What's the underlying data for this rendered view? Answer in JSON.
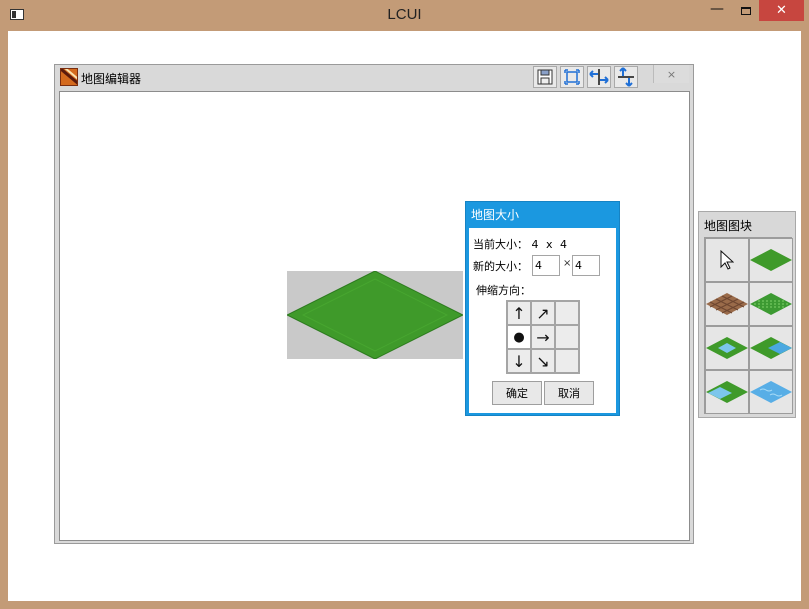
{
  "window": {
    "title": "LCUI"
  },
  "editor": {
    "title": "地图编辑器",
    "toolbar": {
      "save": "save-icon",
      "fit": "fit-frame-icon",
      "flip_horizontal": "flip-horizontal-icon",
      "flip_vertical": "flip-vertical-icon",
      "close_label": "×"
    },
    "colors": {
      "grass": "#3f9a2a",
      "canvas_bg": "#c9c9c9"
    }
  },
  "map_size_dialog": {
    "title": "地图大小",
    "current_size_label": "当前大小：",
    "current_width": "4",
    "current_x": "x",
    "current_height": "4",
    "new_size_label": "新的大小：",
    "new_width": "4",
    "new_x": "×",
    "new_height": "4",
    "direction_label": "伸缩方向：",
    "direction_grid": [
      [
        "arrow-up-icon",
        "arrow-up-right-icon",
        ""
      ],
      [
        "anchor-dot-icon",
        "arrow-right-icon",
        ""
      ],
      [
        "arrow-down-icon",
        "arrow-down-right-icon",
        ""
      ]
    ],
    "ok_label": "确定",
    "cancel_label": "取消",
    "accent": "#1b98e0"
  },
  "tiles_panel": {
    "title": "地图图块",
    "tiles": [
      "cursor-tool-icon",
      "grass-tile",
      "dirt-tile",
      "grass-rows-tile",
      "grass-water-tile-a",
      "water-grass-tile-a",
      "grass-water-tile-b",
      "water-tile"
    ]
  }
}
